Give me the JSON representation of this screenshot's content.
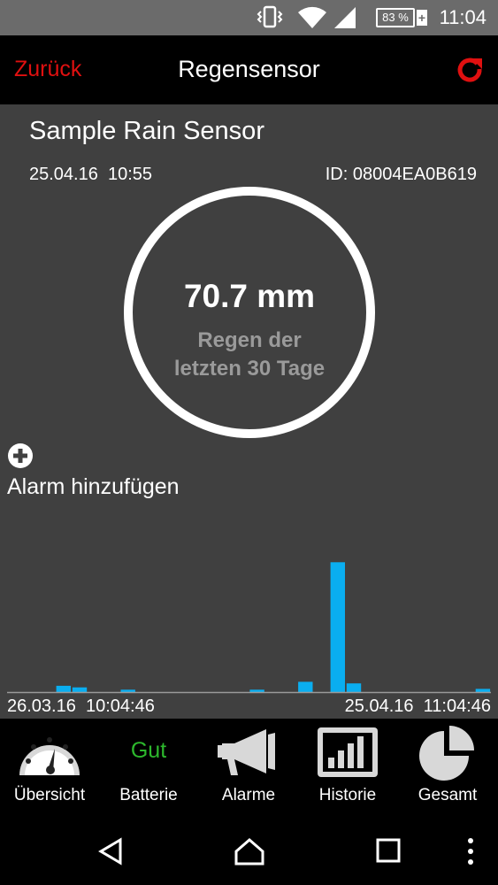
{
  "status_bar": {
    "battery_percent": "83 %",
    "battery_plus": "+",
    "time": "11:04",
    "icons": [
      "vibrate-icon",
      "wifi-icon",
      "signal-icon",
      "battery-icon"
    ]
  },
  "action_bar": {
    "back_label": "Zurück",
    "title": "Regensensor",
    "refresh_icon": "refresh-icon"
  },
  "sensor": {
    "name": "Sample Rain Sensor",
    "date": "25.04.16  10:55",
    "id": "ID: 08004EA0B619",
    "value": "70.7 mm",
    "label_line1": "Regen der",
    "label_line2": "letzten 30 Tage"
  },
  "alarm": {
    "add_label": "Alarm hinzufügen"
  },
  "chart_data": {
    "type": "bar",
    "x_start": "26.03.16  10:04:46",
    "x_end": "25.04.16  11:04:46",
    "values": [
      0,
      0,
      0,
      0.8,
      0.6,
      0,
      0,
      0.3,
      0,
      0,
      0,
      0,
      0,
      0,
      0,
      0.3,
      0,
      0,
      1.3,
      0,
      16.5,
      1.1,
      0,
      0,
      0,
      0,
      0,
      0,
      0,
      0.4
    ],
    "ylim": [
      0,
      18
    ],
    "color": "#0aaef0",
    "axis_color": "#9a9a9a"
  },
  "tabs": [
    {
      "label": "Übersicht",
      "icon": "gauge-icon"
    },
    {
      "label": "Batterie",
      "status": "Gut",
      "status_color": "#2db82d"
    },
    {
      "label": "Alarme",
      "icon": "megaphone-icon"
    },
    {
      "label": "Historie",
      "icon": "bar-chart-icon"
    },
    {
      "label": "Gesamt",
      "icon": "pie-chart-icon"
    }
  ],
  "nav": [
    "back-icon",
    "home-icon",
    "recents-icon",
    "overflow-menu-icon"
  ],
  "colors": {
    "accent": "#e01010",
    "panel": "#404040",
    "status_bar": "#6b6b6b"
  }
}
